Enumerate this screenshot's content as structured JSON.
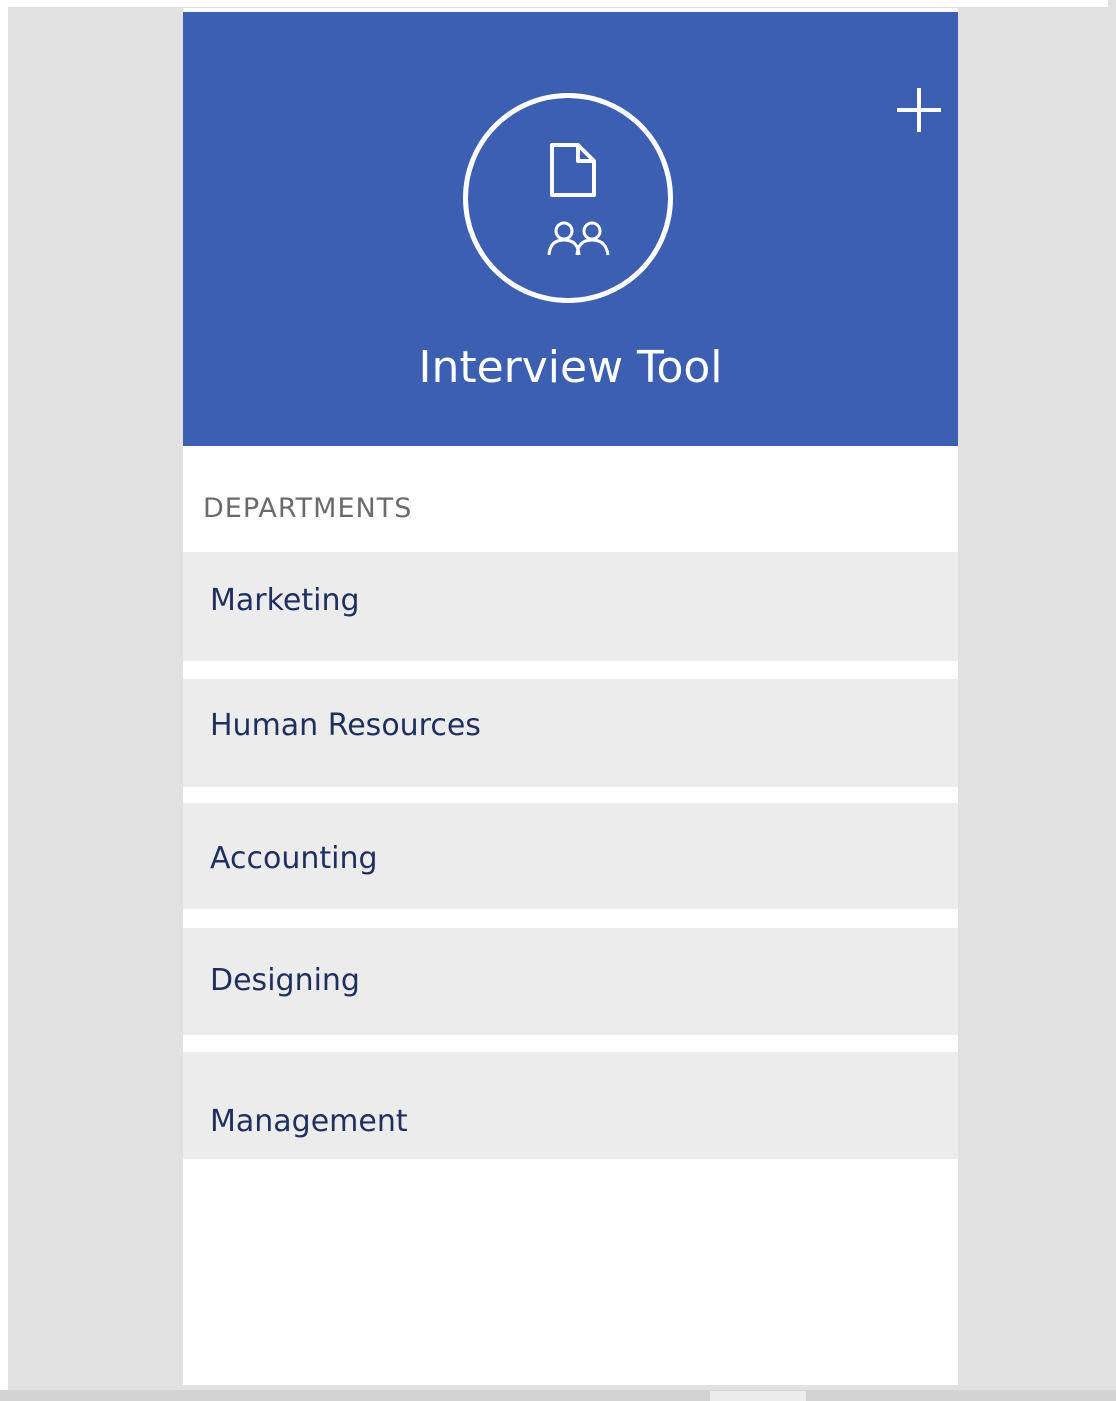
{
  "app": {
    "title": "Interview Tool",
    "add_icon": "plus-icon",
    "logo_icons": [
      "document-icon",
      "people-icon"
    ]
  },
  "colors": {
    "header": "#3c5fb1",
    "list_item": "#ececec",
    "list_text": "#1f2f5e",
    "section_label": "#6b6b6b",
    "background": "#e1e1e1"
  },
  "departments": {
    "label": "DEPARTMENTS",
    "items": [
      {
        "label": "Marketing"
      },
      {
        "label": "Human Resources"
      },
      {
        "label": "Accounting"
      },
      {
        "label": "Designing"
      },
      {
        "label": "Management"
      }
    ]
  }
}
